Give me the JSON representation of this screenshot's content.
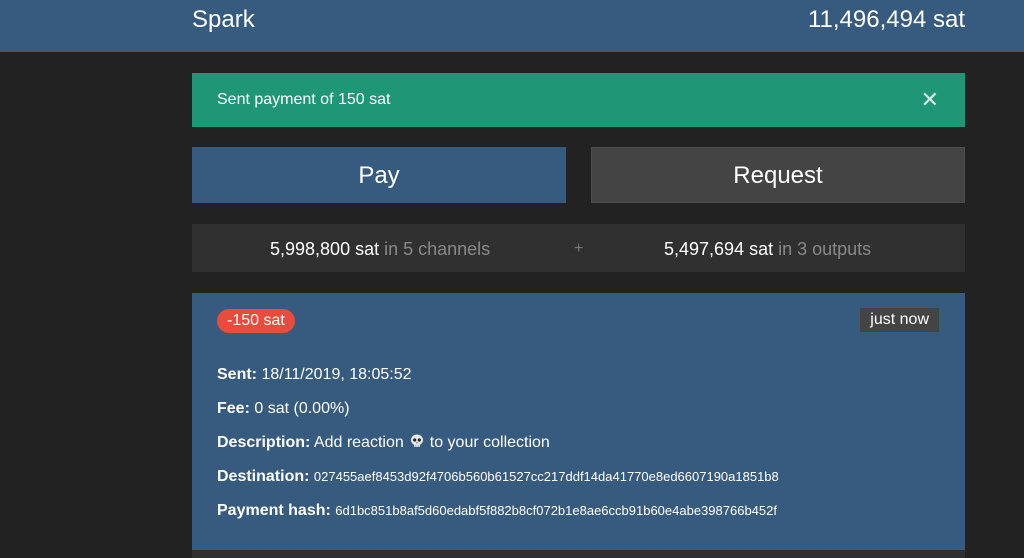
{
  "header": {
    "brand": "Spark",
    "balance": "11,496,494 sat"
  },
  "alert": {
    "message": "Sent payment of 150 sat",
    "close_icon": "close-icon"
  },
  "actions": {
    "pay_label": "Pay",
    "request_label": "Request"
  },
  "funds": {
    "channels_amount": "5,998,800 sat",
    "channels_suffix": "in 5 channels",
    "plus": "+",
    "outputs_amount": "5,497,694 sat",
    "outputs_suffix": "in 3 outputs"
  },
  "payment": {
    "amount_badge": "-150 sat",
    "time_badge": "just now",
    "sent_label": "Sent:",
    "sent_value": "18/11/2019, 18:05:52",
    "fee_label": "Fee:",
    "fee_value": "0 sat (0.00%)",
    "description_label": "Description:",
    "description_before": "Add reaction",
    "description_icon": "skull-icon",
    "description_after": "to your collection",
    "destination_label": "Destination:",
    "destination_value": "027455aef8453d92f4706b560b61527cc217ddf14da41770e8ed6607190a1851b8",
    "hash_label": "Payment hash:",
    "hash_value": "6d1bc851b8af5d60edabf5f882b8cf072b1e8ae6ccb91b60e4abe398766b452f"
  },
  "colors": {
    "primary": "#375a7f",
    "success": "#1f9676",
    "danger": "#e74c3c",
    "background": "#222222"
  }
}
